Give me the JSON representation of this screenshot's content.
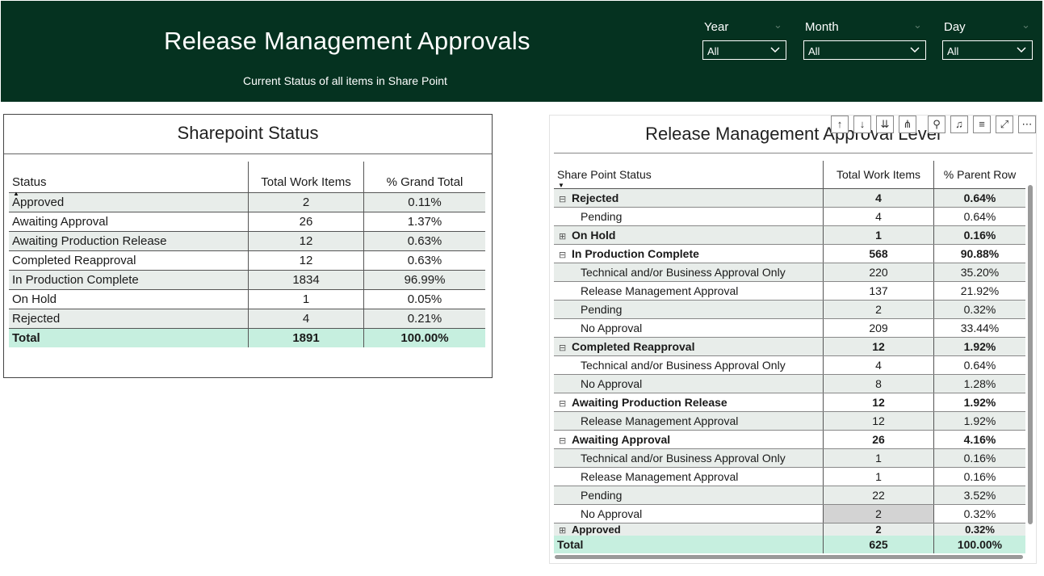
{
  "header": {
    "title": "Release Management Approvals",
    "subtitle": "Current Status of all items in Share Point",
    "slicers": [
      {
        "label": "Year",
        "value": "All"
      },
      {
        "label": "Month",
        "value": "All"
      },
      {
        "label": "Day",
        "value": "All"
      }
    ]
  },
  "left": {
    "title": "Sharepoint Status",
    "columns": [
      "Status",
      "Total Work Items",
      "% Grand Total"
    ],
    "rows": [
      {
        "status": "Approved",
        "items": "2",
        "pct": "0.11%"
      },
      {
        "status": "Awaiting Approval",
        "items": "26",
        "pct": "1.37%"
      },
      {
        "status": "Awaiting Production Release",
        "items": "12",
        "pct": "0.63%"
      },
      {
        "status": "Completed Reapproval",
        "items": "12",
        "pct": "0.63%"
      },
      {
        "status": "In Production Complete",
        "items": "1834",
        "pct": "96.99%"
      },
      {
        "status": "On Hold",
        "items": "1",
        "pct": "0.05%"
      },
      {
        "status": "Rejected",
        "items": "4",
        "pct": "0.21%"
      }
    ],
    "total": {
      "label": "Total",
      "items": "1891",
      "pct": "100.00%"
    }
  },
  "right": {
    "title": "Release Management Approval Level",
    "columns": [
      "Share Point Status",
      "Total Work Items",
      "% Parent Row"
    ],
    "rows": [
      {
        "level": "parent",
        "expander": "⊟",
        "label": "Rejected",
        "items": "4",
        "pct": "0.64%"
      },
      {
        "level": "child",
        "label": "Pending",
        "items": "4",
        "pct": "0.64%"
      },
      {
        "level": "parent",
        "expander": "⊞",
        "label": "On Hold",
        "items": "1",
        "pct": "0.16%"
      },
      {
        "level": "parent",
        "expander": "⊟",
        "label": "In Production Complete",
        "items": "568",
        "pct": "90.88%"
      },
      {
        "level": "child",
        "label": "Technical and/or Business Approval Only",
        "items": "220",
        "pct": "35.20%"
      },
      {
        "level": "child",
        "label": "Release Management Approval",
        "items": "137",
        "pct": "21.92%"
      },
      {
        "level": "child",
        "label": "Pending",
        "items": "2",
        "pct": "0.32%"
      },
      {
        "level": "child",
        "label": "No Approval",
        "items": "209",
        "pct": "33.44%"
      },
      {
        "level": "parent",
        "expander": "⊟",
        "label": "Completed Reapproval",
        "items": "12",
        "pct": "1.92%"
      },
      {
        "level": "child",
        "label": "Technical and/or Business Approval Only",
        "items": "4",
        "pct": "0.64%"
      },
      {
        "level": "child",
        "label": "No Approval",
        "items": "8",
        "pct": "1.28%"
      },
      {
        "level": "parent",
        "expander": "⊟",
        "label": "Awaiting Production Release",
        "items": "12",
        "pct": "1.92%"
      },
      {
        "level": "child",
        "label": "Release Management Approval",
        "items": "12",
        "pct": "1.92%"
      },
      {
        "level": "parent",
        "expander": "⊟",
        "label": "Awaiting Approval",
        "items": "26",
        "pct": "4.16%"
      },
      {
        "level": "child",
        "label": "Technical and/or Business Approval Only",
        "items": "1",
        "pct": "0.16%"
      },
      {
        "level": "child",
        "label": "Release Management Approval",
        "items": "1",
        "pct": "0.16%"
      },
      {
        "level": "child",
        "label": "Pending",
        "items": "22",
        "pct": "3.52%"
      },
      {
        "level": "child",
        "label": "No Approval",
        "items": "2",
        "pct": "0.32%",
        "highlight": true
      },
      {
        "level": "cut",
        "expander": "⊞",
        "label": "Approved",
        "items": "2",
        "pct": "0.32%"
      }
    ],
    "total": {
      "label": "Total",
      "items": "625",
      "pct": "100.00%"
    },
    "toolbar": [
      "arrow-up-icon",
      "arrow-down-icon",
      "expand-all-icon",
      "drill-hierarchy-icon",
      "pin-icon",
      "bell-icon",
      "filter-icon",
      "focus-mode-icon",
      "more-options-icon"
    ]
  },
  "colors": {
    "header_bg": "#053220",
    "alt_row": "#e8edea",
    "total_row": "#c6efdf"
  }
}
